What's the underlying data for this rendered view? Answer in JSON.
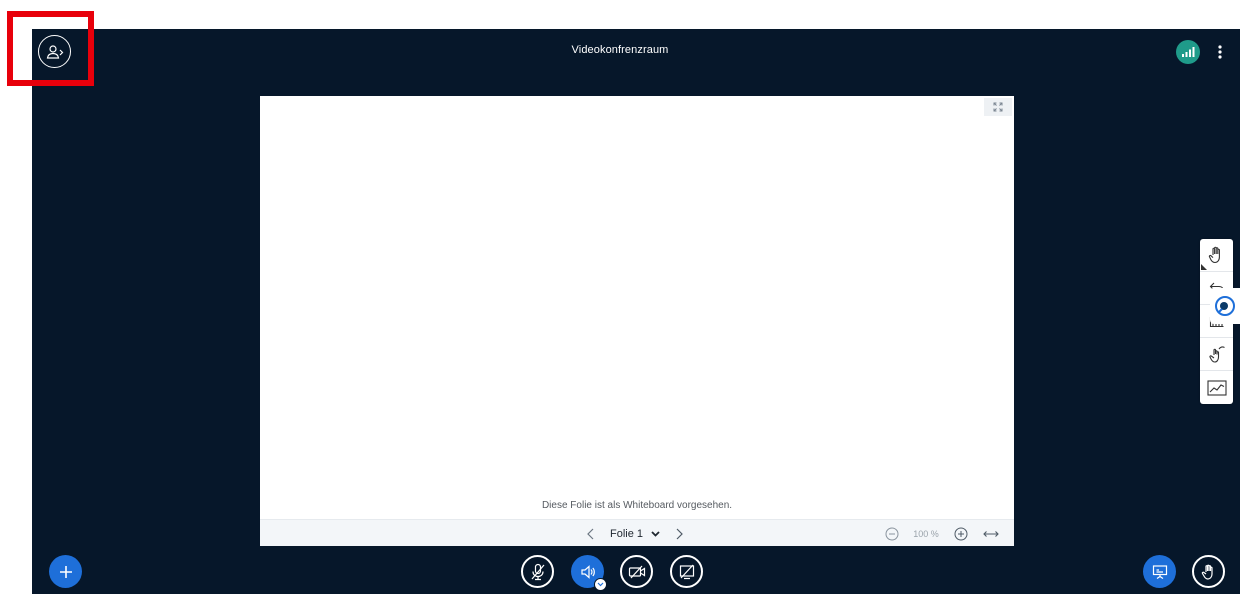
{
  "header": {
    "title": "Videokonfrenzraum"
  },
  "presentation": {
    "whiteboard_note": "Diese Folie ist als Whiteboard vorgesehen.",
    "slide_label": "Folie 1",
    "zoom_level": "100 %"
  },
  "icons": {
    "user_toggle": "user-list-toggle-icon",
    "connection": "signal-bars-icon",
    "options": "vertical-dots-icon",
    "fullscreen": "fullscreen-icon",
    "prev": "chevron-left-icon",
    "next": "chevron-right-icon",
    "dropdown": "chevron-down-icon",
    "zoom_out": "zoom-out-icon",
    "zoom_in": "zoom-in-icon",
    "fit_width": "fit-width-icon",
    "actions": "plus-icon",
    "microphone": "microphone-muted-icon",
    "audio": "speaker-icon",
    "camera": "camera-off-icon",
    "screenshare": "screenshare-off-icon",
    "presentation": "presentation-icon",
    "raise_hand": "raise-hand-icon",
    "tools": [
      "hand-pan-icon",
      "undo-icon",
      "multi-user-whiteboard-icon",
      "pointer-icon",
      "ruler-icon",
      "gesture-icon",
      "line-chart-icon"
    ]
  },
  "colors": {
    "background": "#06172a",
    "accent_blue": "#1e6fd9",
    "connection_green": "#1f9b8a",
    "highlight_red": "#e8000b"
  }
}
